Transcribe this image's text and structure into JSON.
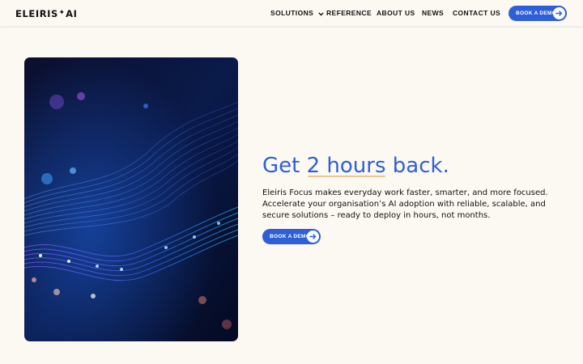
{
  "header": {
    "logo": {
      "left": "ELEIRIS",
      "mark": "✦",
      "right": "AI"
    },
    "nav": {
      "solutions": "SOLUTIONS",
      "reference": "REFERENCE",
      "about": "ABOUT US",
      "news": "NEWS",
      "contact": "CONTACT US"
    },
    "cta": "BOOK A DEMO"
  },
  "hero": {
    "image_alt": "abstract blue light waves",
    "headline_prefix": "Get ",
    "headline_highlight": "2 hours",
    "headline_suffix": " back.",
    "description": "Eleiris Focus makes everyday work faster, smarter, and more focused. Accelerate your organisation’s AI adoption with reliable, scalable, and secure solutions – ready to deploy in hours, not months.",
    "cta": "BOOK A DEMO"
  },
  "colors": {
    "background": "#fcf9f2",
    "accent": "#2f5fd6",
    "highlight_underline": "#e9c58f"
  },
  "icons": [
    "chevron-down-icon",
    "arrow-right-icon"
  ]
}
